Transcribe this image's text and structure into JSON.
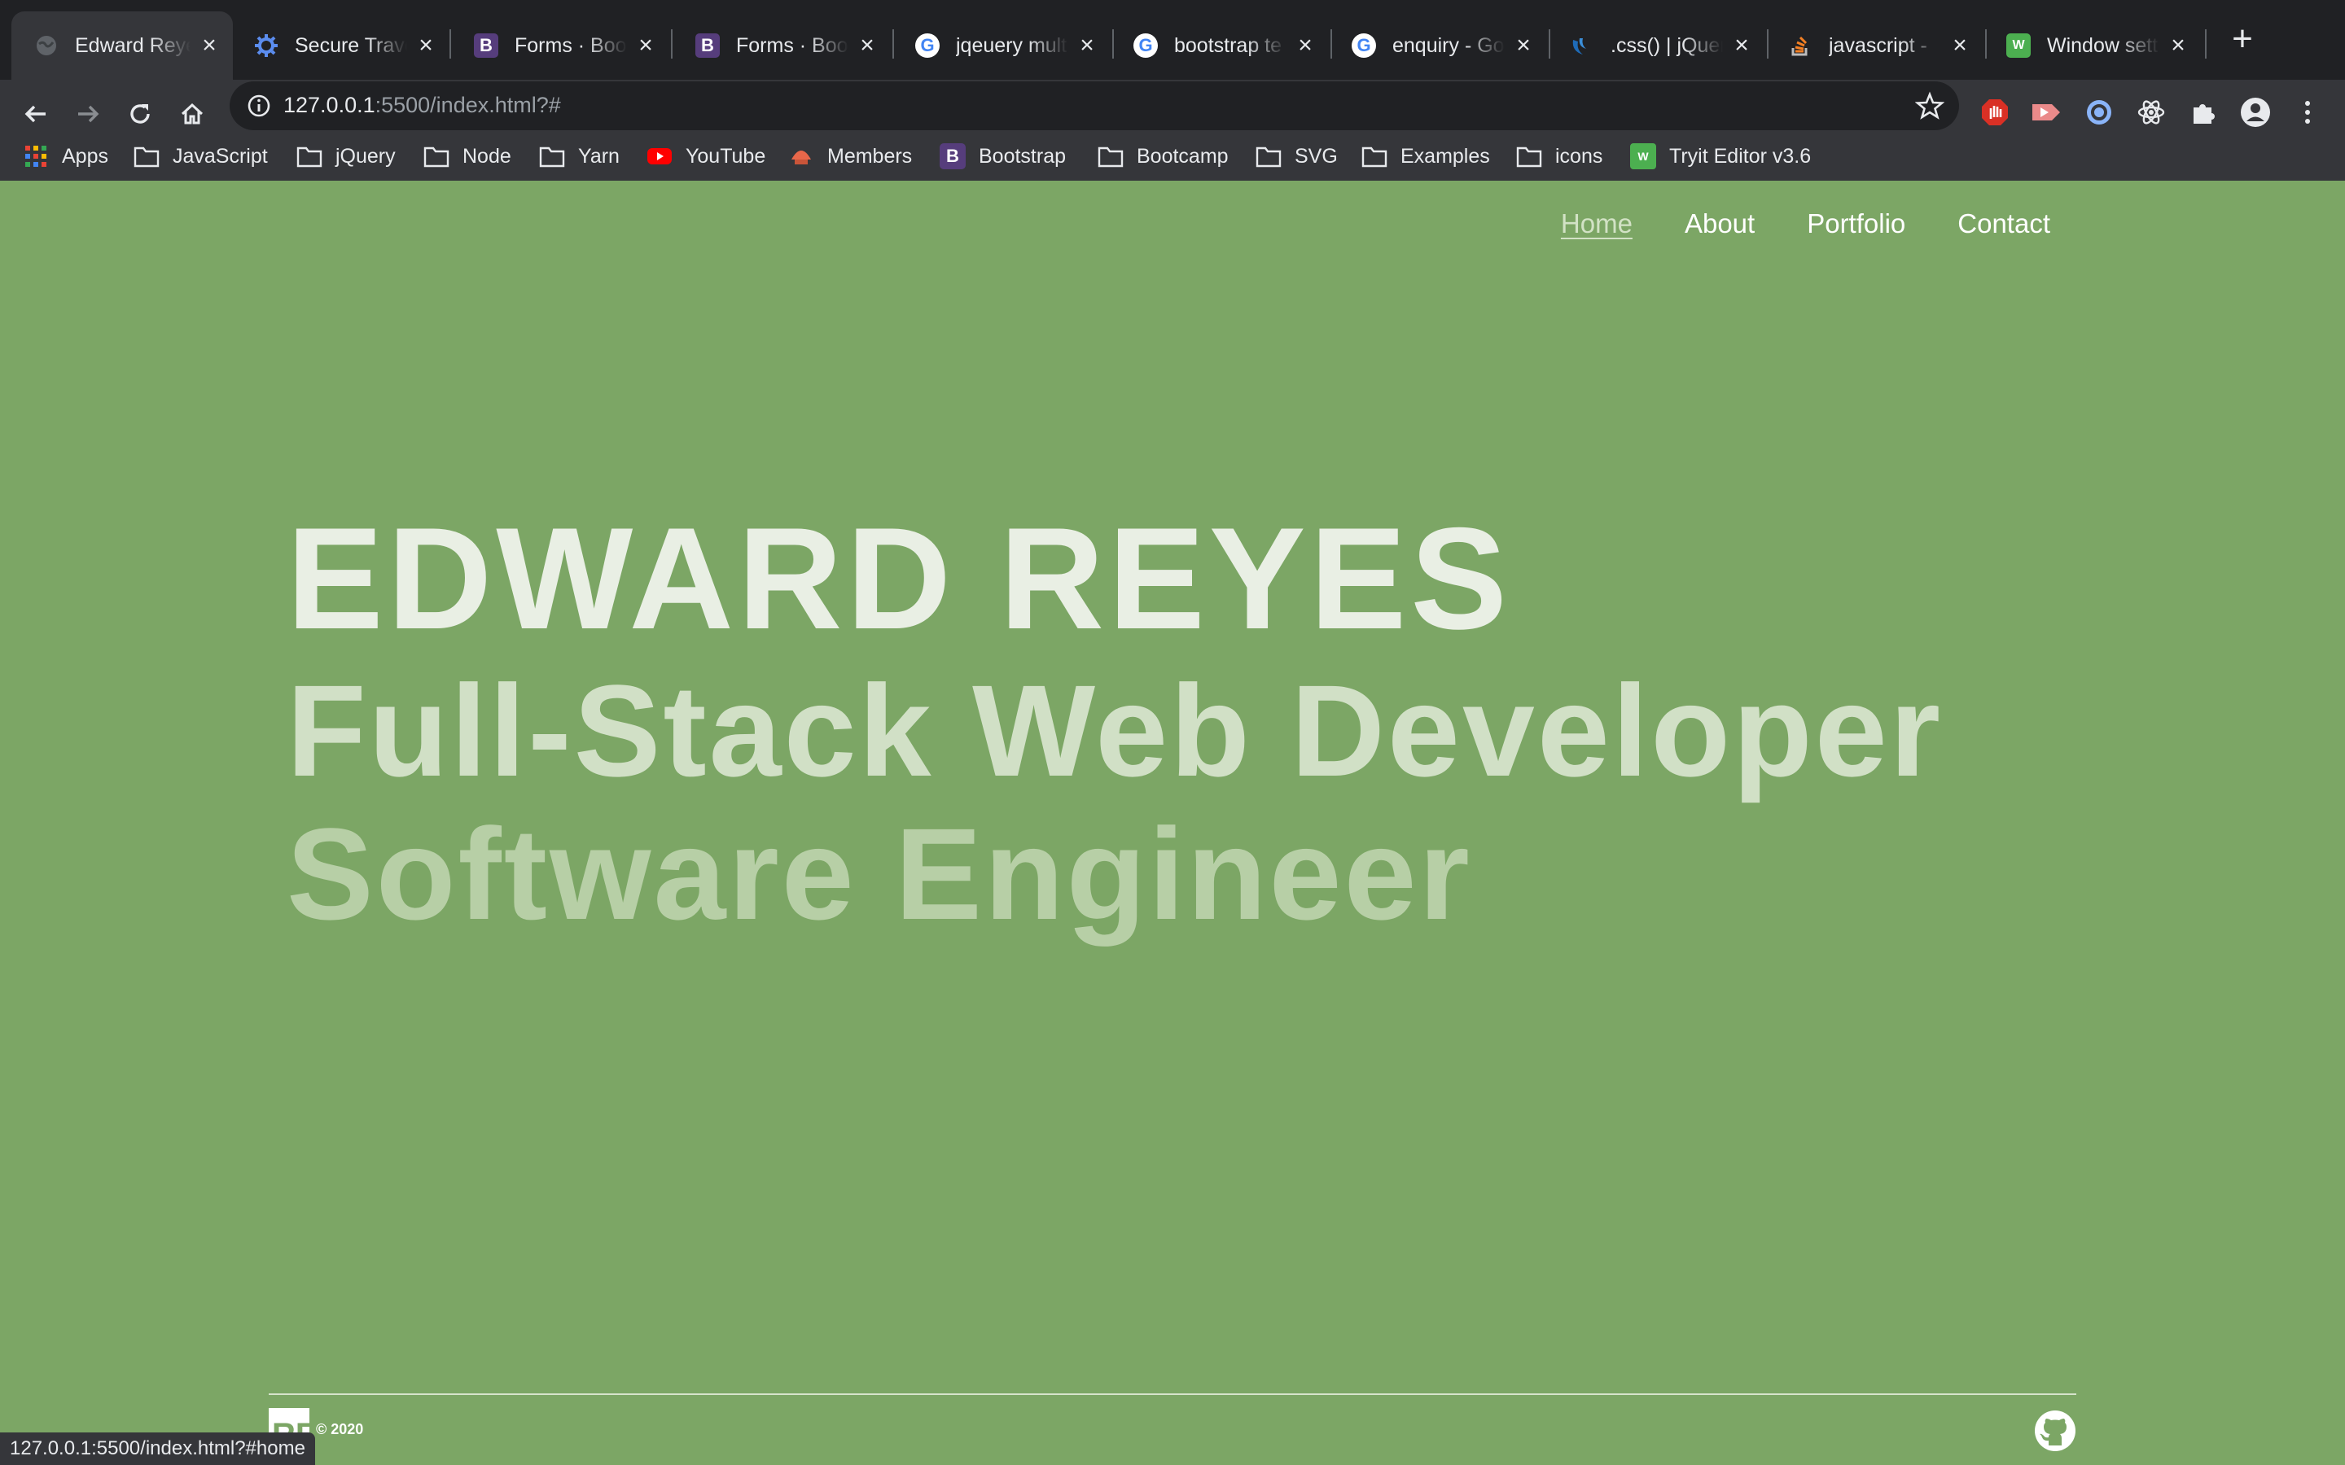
{
  "browser": {
    "tabs": [
      {
        "title": "Edward Reyes",
        "favicon": "globe-icon",
        "active": true
      },
      {
        "title": "Secure Travel",
        "favicon": "gear-blue-icon",
        "active": false
      },
      {
        "title": "Forms · Bootstrap",
        "favicon": "bootstrap-icon",
        "active": false
      },
      {
        "title": "Forms · Bootstrap",
        "favicon": "bootstrap-icon",
        "active": false
      },
      {
        "title": "jqeuery multi",
        "favicon": "google-icon",
        "active": false
      },
      {
        "title": "bootstrap te",
        "favicon": "google-icon",
        "active": false
      },
      {
        "title": "enquiry - Go",
        "favicon": "google-icon",
        "active": false
      },
      {
        "title": ".css() | jQuery",
        "favicon": "jquery-icon",
        "active": false
      },
      {
        "title": "javascript - ",
        "favicon": "stackoverflow-icon",
        "active": false
      },
      {
        "title": "Window sett",
        "favicon": "tryit-icon",
        "active": false
      }
    ],
    "address": {
      "host": "127.0.0.1",
      "rest": ":5500/index.html?#"
    },
    "bookmarks": [
      {
        "label": "Apps",
        "icon": "apps-grid-icon"
      },
      {
        "label": "JavaScript",
        "icon": "folder-icon"
      },
      {
        "label": "jQuery",
        "icon": "folder-icon"
      },
      {
        "label": "Node",
        "icon": "folder-icon"
      },
      {
        "label": "Yarn",
        "icon": "folder-icon"
      },
      {
        "label": "YouTube",
        "icon": "youtube-icon"
      },
      {
        "label": "Members",
        "icon": "members-icon"
      },
      {
        "label": "Bootstrap",
        "icon": "bootstrap-icon"
      },
      {
        "label": "Bootcamp",
        "icon": "folder-icon"
      },
      {
        "label": "SVG",
        "icon": "folder-icon"
      },
      {
        "label": "Examples",
        "icon": "folder-icon"
      },
      {
        "label": "icons",
        "icon": "folder-icon"
      },
      {
        "label": "Tryit Editor v3.6",
        "icon": "tryit-icon"
      }
    ],
    "status_url": "127.0.0.1:5500/index.html?#home"
  },
  "site": {
    "nav": [
      "Home",
      "About",
      "Portfolio",
      "Contact"
    ],
    "hero": {
      "name": "EDWARD REYES",
      "role1": "Full-Stack Web Developer",
      "role2": "Software Engineer"
    },
    "footer": {
      "copyright": "© 2020",
      "logo_text": "RE"
    }
  },
  "colors": {
    "page_bg": "#7ca665",
    "hero_name": "#e9efe4",
    "hero_role1": "#d1e0c6",
    "hero_role2": "#b7cfa6",
    "chrome_dark": "#202124",
    "chrome_mid": "#35363a"
  }
}
